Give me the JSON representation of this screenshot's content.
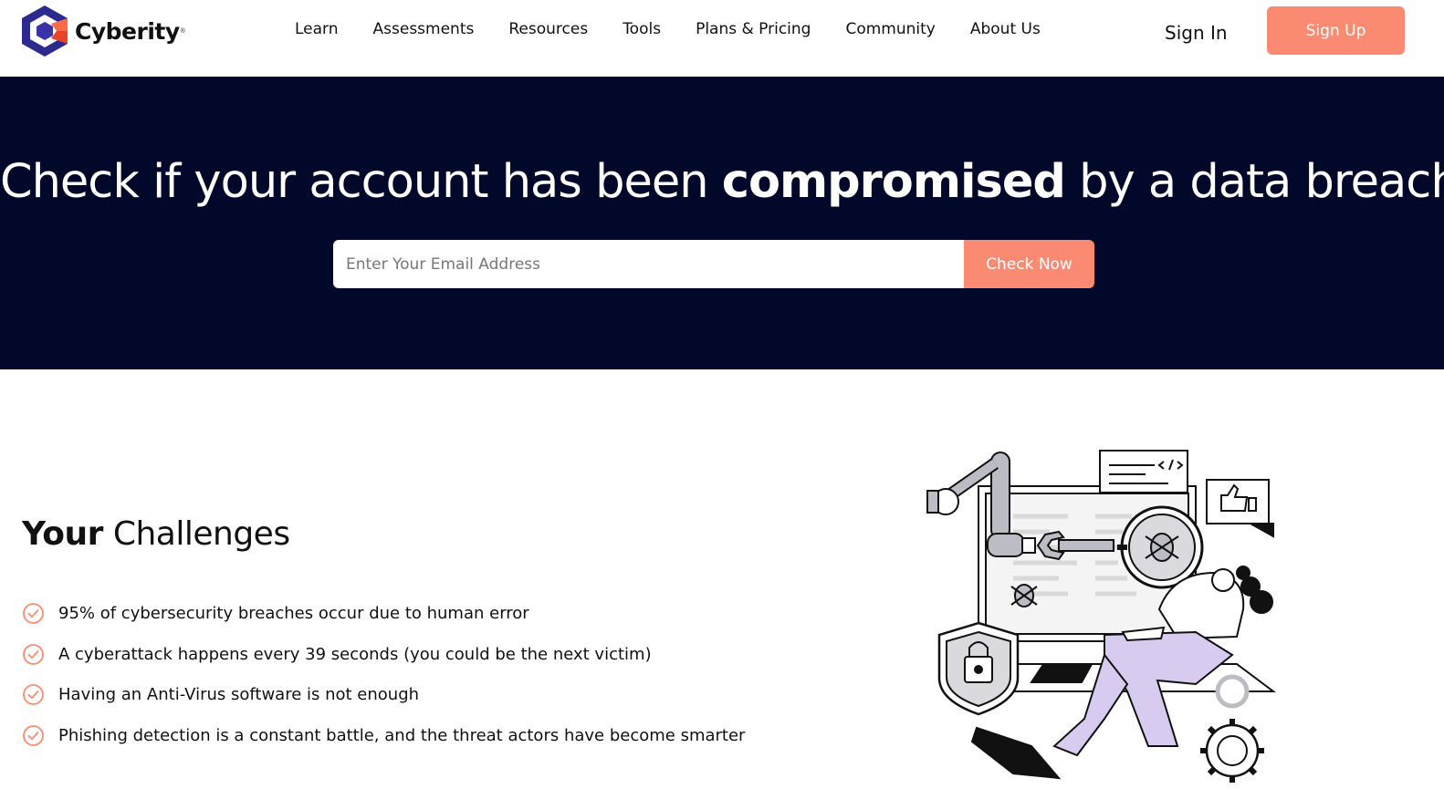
{
  "header": {
    "logo_text": "Cyberity",
    "logo_tm": "®",
    "nav": [
      "Learn",
      "Assessments",
      "Resources",
      "Tools",
      "Plans & Pricing",
      "Community",
      "About Us"
    ],
    "sign_in": "Sign In",
    "sign_up": "Sign Up"
  },
  "hero": {
    "title_before": "Check if your account has been ",
    "title_bold": "compromised",
    "title_after": " by a data breach",
    "email_placeholder": "Enter Your Email Address",
    "check_button": "Check Now"
  },
  "challenges": {
    "title_bold": "Your",
    "title_rest": " Challenges",
    "items": [
      "95% of cybersecurity breaches occur due to human error",
      "A cyberattack happens every 39 seconds (you could be the next victim)",
      "Having an Anti-Virus software is not enough",
      "Phishing detection is a constant battle, and the threat actors have become smarter"
    ]
  },
  "colors": {
    "accent": "#fa8a72",
    "hero_bg": "#020829",
    "logo_primary": "#3a32a8",
    "illustration_purple": "#d7ccef"
  },
  "icons": {
    "check": "check-circle-icon",
    "logo": "cyberity-logo-icon"
  }
}
